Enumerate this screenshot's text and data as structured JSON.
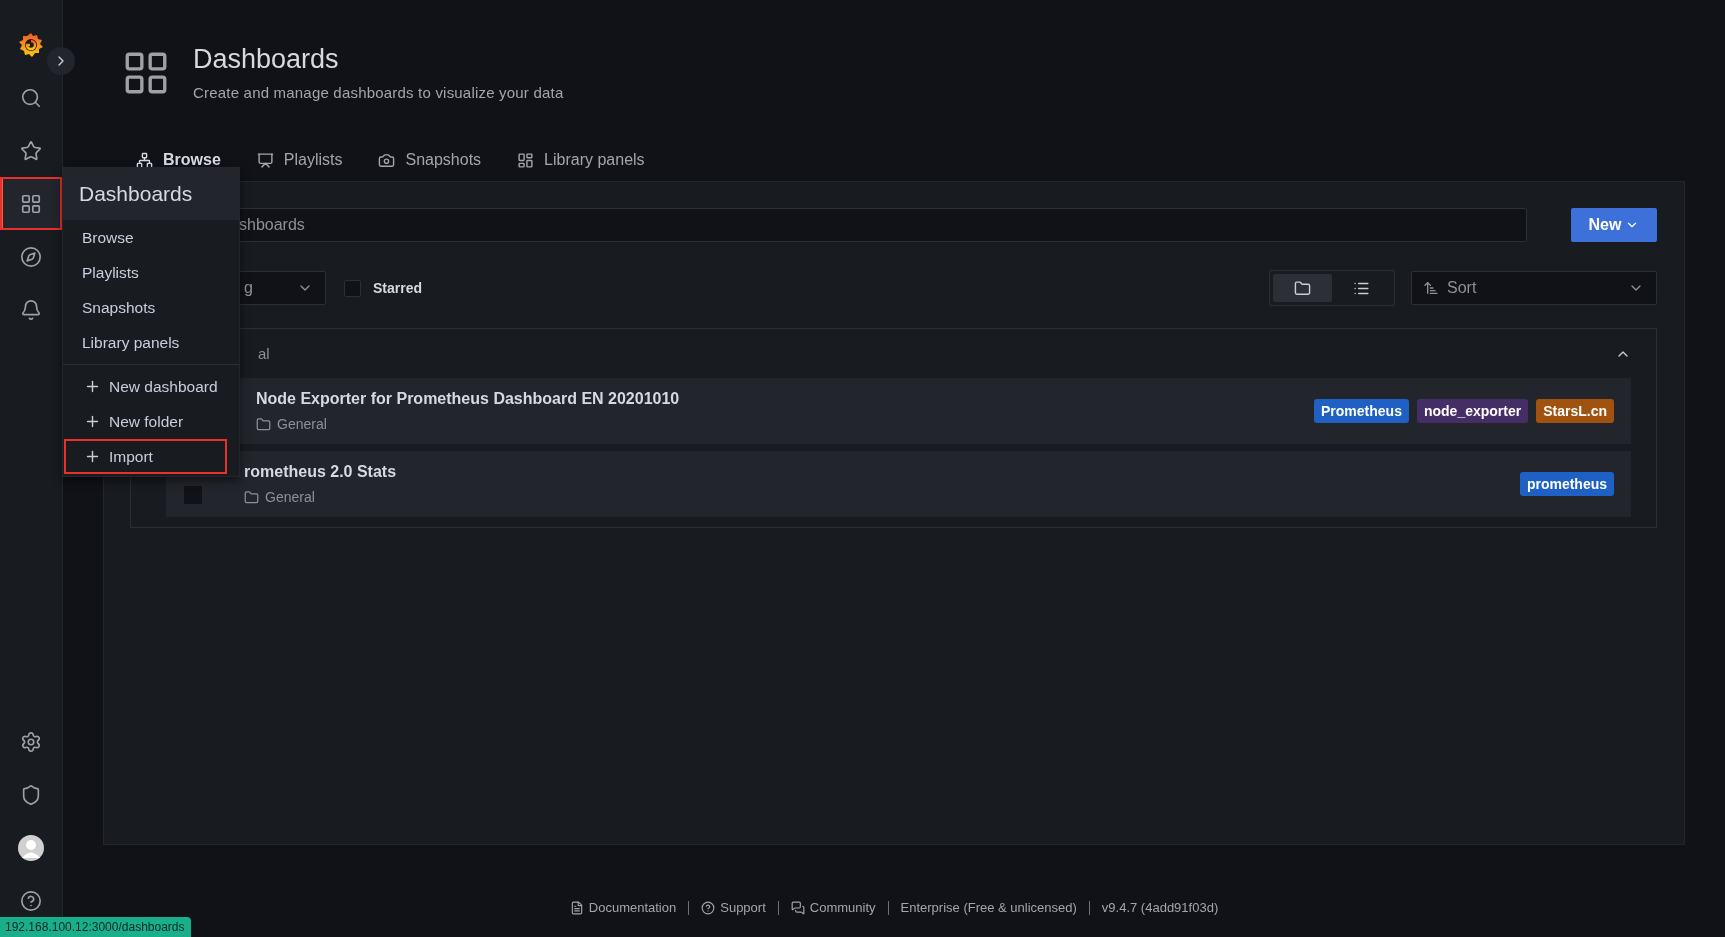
{
  "sidebar": {
    "items": [
      {
        "selected": false,
        "highlighted": false
      },
      {
        "selected": false,
        "highlighted": false
      },
      {
        "selected": false,
        "highlighted": false
      },
      {
        "selected": true,
        "highlighted": true
      },
      {
        "selected": false,
        "highlighted": false
      },
      {
        "selected": false,
        "highlighted": false
      }
    ],
    "bottom_items": [
      {
        "selected": false
      },
      {
        "selected": false
      },
      {
        "selected": false
      },
      {
        "selected": false
      }
    ]
  },
  "menu": {
    "title": "Dashboards",
    "items": [
      {
        "label": "Browse",
        "kind": "link",
        "highlighted": false
      },
      {
        "label": "Playlists",
        "kind": "link",
        "highlighted": false
      },
      {
        "label": "Snapshots",
        "kind": "link",
        "highlighted": false
      },
      {
        "label": "Library panels",
        "kind": "link",
        "highlighted": false
      },
      {
        "label": "New dashboard",
        "kind": "action",
        "highlighted": false
      },
      {
        "label": "New folder",
        "kind": "action",
        "highlighted": false
      },
      {
        "label": "Import",
        "kind": "action",
        "highlighted": true
      }
    ]
  },
  "header": {
    "title": "Dashboards",
    "subtitle": "Create and manage dashboards to visualize your data"
  },
  "tabs": [
    {
      "label": "Browse",
      "selected": true
    },
    {
      "label": "Playlists",
      "selected": false
    },
    {
      "label": "Snapshots",
      "selected": false
    },
    {
      "label": "Library panels",
      "selected": false
    }
  ],
  "search": {
    "placeholder": "shboards"
  },
  "new_button": "New",
  "tag_filter": {
    "placeholder": "g"
  },
  "starred": {
    "label": "Starred",
    "checked": false
  },
  "view_modes": [
    {
      "selected": true
    },
    {
      "selected": false
    }
  ],
  "sort": {
    "placeholder": "Sort"
  },
  "folder": {
    "title": "al",
    "expanded": true,
    "dashboards": [
      {
        "title": "Node Exporter for Prometheus Dashboard EN 20201010",
        "folder": "General",
        "tags": [
          {
            "label": "Prometheus",
            "color": "#1f60c4"
          },
          {
            "label": "node_exporter",
            "color": "#452d66"
          },
          {
            "label": "StarsL.cn",
            "color": "#a1520e"
          }
        ]
      },
      {
        "title": "rometheus 2.0 Stats",
        "folder": "General",
        "checked": false,
        "tags": [
          {
            "label": "prometheus",
            "color": "#1f60c4"
          }
        ]
      }
    ]
  },
  "footer": [
    "Documentation",
    "Support",
    "Community",
    "Enterprise (Free & unlicensed)",
    "v9.4.7 (4add91f03d)"
  ],
  "status_url": "192.168.100.12:3000/dashboards"
}
